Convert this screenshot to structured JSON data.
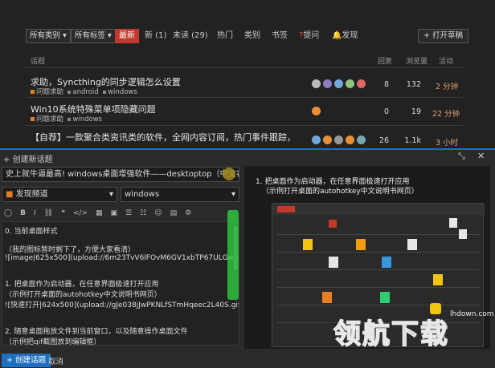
{
  "nav": {
    "category_dropdown": "所有类别",
    "tag_dropdown": "所有标签",
    "tabs": [
      "最新",
      "新 (1)",
      "未读 (29)",
      "热门",
      "类别",
      "书签",
      "提问",
      "发现"
    ],
    "draft_button": "打开草稿"
  },
  "table": {
    "headers": {
      "topic": "话题",
      "replies": "回复",
      "views": "浏览量",
      "activity": "活动"
    }
  },
  "topics": [
    {
      "title": "求助，Syncthing的同步逻辑怎么设置",
      "category": "问题求助",
      "tag": "android",
      "tag2": "windows",
      "replies": "8",
      "views": "132",
      "activity": "2 分钟"
    },
    {
      "title": "Win10系统特殊菜单项隐藏问题",
      "category": "问题求助",
      "tag": "windows",
      "replies": "0",
      "views": "19",
      "activity": "22 分钟"
    },
    {
      "title": "【自荐】一款聚合类资讯类的软件，全网内容订阅，热门事件跟踪，无广告简约风",
      "replies": "26",
      "views": "1.1k",
      "activity": "3 小时"
    }
  ],
  "composer": {
    "header": "创建新话题",
    "title_value": "史上就牛逼最高! windows桌面增强软件——desktoptop（中文名：这名叫啥呢好）",
    "category_value": "发现频道",
    "tag_value": "windows",
    "editor_lines": [
      "0. 当前桌面样式",
      "",
      "（我的图标暂时剩下了，方便大家看清）",
      "![image|625x500](upload://6m23TvV6lFOvM6GV1xbTP67ULGw.png)",
      "",
      "",
      "1. 把桌面作为启动器，在任意界面极速打开应用",
      "（示例打开桌面的autohotkey中文说明书网页）",
      "![快速打开|624x500](upload://gJe038jJwPKNLfSTmHqeec2L40S.gif)",
      "",
      "",
      "2. 随意桌面拖放文件到当前窗口，以及随意操作桌面文件",
      "（示例把gif截图放到编辑框）"
    ],
    "preview_line1": "1. 把桌面作为启动器，在任意界面极速打开应用",
    "preview_line2": "（示例打开桌面的autohotkey中文说明书网页）",
    "submit_label": "创建话题",
    "cancel_label": "取消"
  },
  "watermark": {
    "site": "lhdown.com"
  },
  "colors": {
    "accent": "#1e6fbf",
    "active_tab": "#c0392b",
    "activity": "#e0a070"
  }
}
